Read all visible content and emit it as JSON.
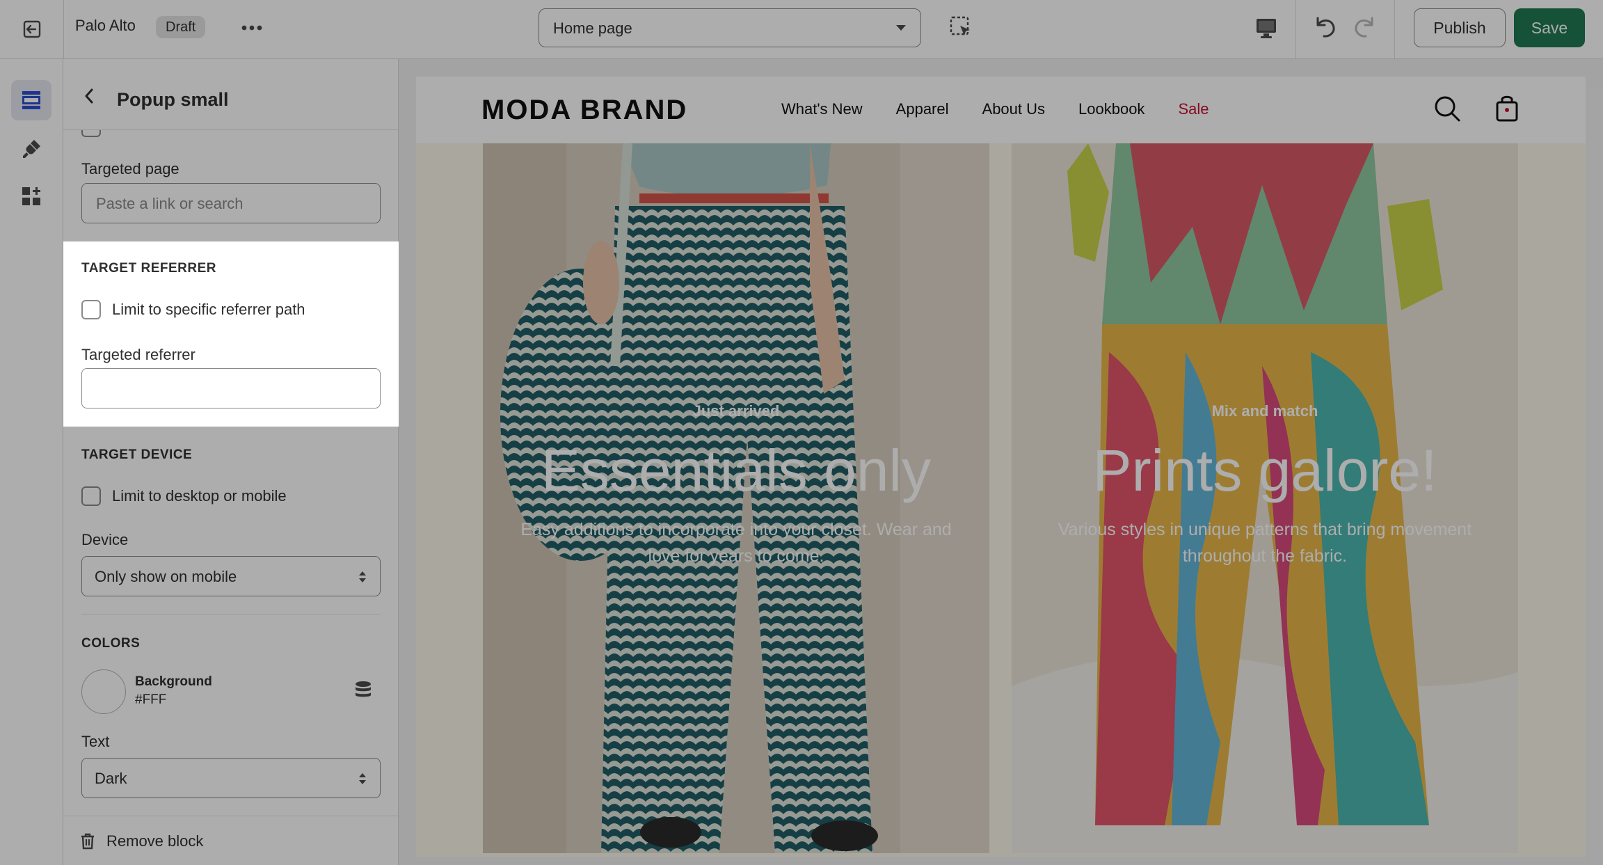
{
  "topbar": {
    "store_name": "Palo Alto",
    "status_badge": "Draft",
    "template_select": "Home page",
    "publish_label": "Publish",
    "save_label": "Save",
    "icons": [
      "exit-icon",
      "more-icon",
      "chevron-down-icon",
      "inspect-icon",
      "desktop-icon",
      "undo-icon",
      "redo-icon"
    ]
  },
  "rail": {
    "items": [
      "sections-icon",
      "theme-settings-icon",
      "apps-icon"
    ]
  },
  "panel": {
    "title": "Popup small",
    "targeted_page": {
      "label": "Targeted page",
      "placeholder": "Paste a link or search"
    },
    "target_referrer": {
      "heading": "TARGET REFERRER",
      "checkbox_label": "Limit to specific referrer path",
      "checked": false,
      "field_label": "Targeted referrer",
      "value": ""
    },
    "target_device": {
      "heading": "TARGET DEVICE",
      "checkbox_label": "Limit to desktop or mobile",
      "checked": false,
      "device_label": "Device",
      "device_value": "Only show on mobile"
    },
    "colors": {
      "heading": "COLORS",
      "background_label": "Background",
      "background_value": "#FFF",
      "text_label": "Text",
      "text_value": "Dark"
    },
    "remove_label": "Remove block"
  },
  "preview": {
    "brand": "MODA BRAND",
    "nav": [
      "What's New",
      "Apparel",
      "About Us",
      "Lookbook",
      "Sale"
    ],
    "sale_color": "#c8102e",
    "heroes": [
      {
        "eyebrow": "Just arrived",
        "headline": "Essentials only",
        "text": "Easy additions to incorporate into your closet. Wear and love for years to come."
      },
      {
        "eyebrow": "Mix and match",
        "headline": "Prints galore!",
        "text": "Various styles in unique patterns that bring movement throughout the fabric."
      }
    ]
  },
  "colors": {
    "accent_save": "#1f7a52",
    "overlay": "rgba(0,0,0,0.32)"
  }
}
